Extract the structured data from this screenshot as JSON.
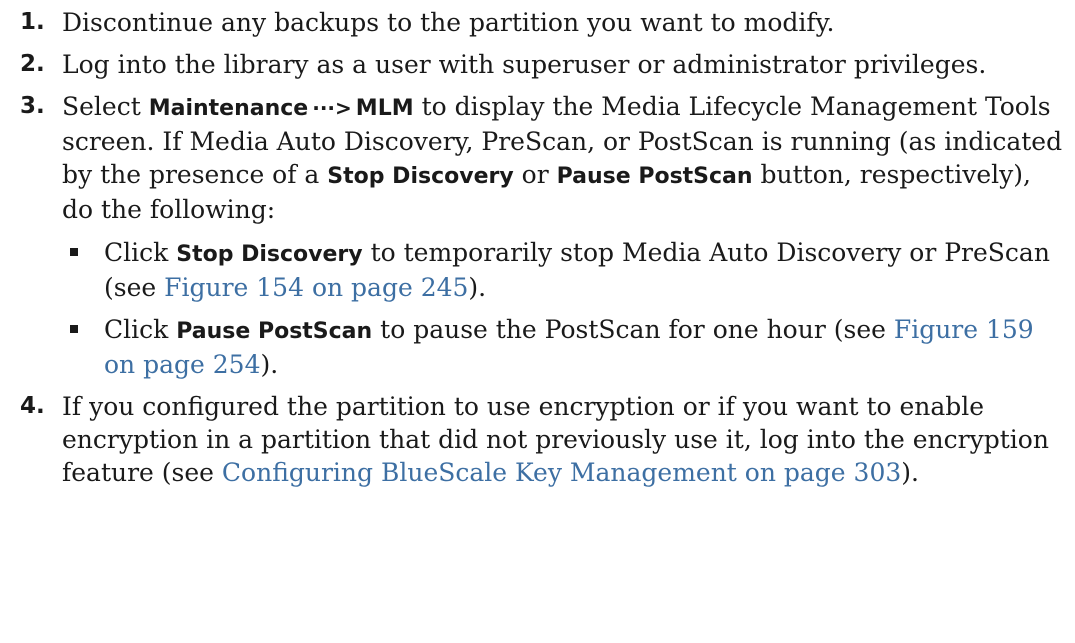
{
  "steps": [
    {
      "number": "1.",
      "text": "Discontinue any backups to the partition you want to modify."
    },
    {
      "number": "2.",
      "text": "Log into the library as a user with superuser or administrator privileges."
    },
    {
      "number": "3.",
      "select": "Select",
      "menu1": "Maintenance",
      "arrow": "···>",
      "menu2": "MLM",
      "text_a": "to display the Media Lifecycle Management Tools screen. If Media Auto Discovery, PreScan, or PostScan is running (as indicated by the presence of a",
      "btn_stop": "Stop Discovery",
      "or": "or",
      "btn_pause": "Pause PostScan",
      "text_b": "button, respectively), do the following:",
      "bullets": [
        {
          "click": "Click",
          "button": "Stop Discovery",
          "text": "to temporarily stop Media Auto Discovery or PreScan (see",
          "link": "Figure 154 on page 245",
          "end": ")."
        },
        {
          "click": "Click",
          "button": "Pause PostScan",
          "text": "to pause the PostScan for one hour (see",
          "link": "Figure 159 on page 254",
          "end": ")."
        }
      ]
    },
    {
      "number": "4.",
      "text": "If you configured the partition to use encryption or if you want to enable encryption in a partition that did not previously use it, log into the encryption feature (see",
      "link": "Configuring BlueScale Key Management on page 303",
      "end": ")."
    }
  ],
  "colors": {
    "text": "#1a1a1a",
    "link": "#3d6fa3"
  }
}
